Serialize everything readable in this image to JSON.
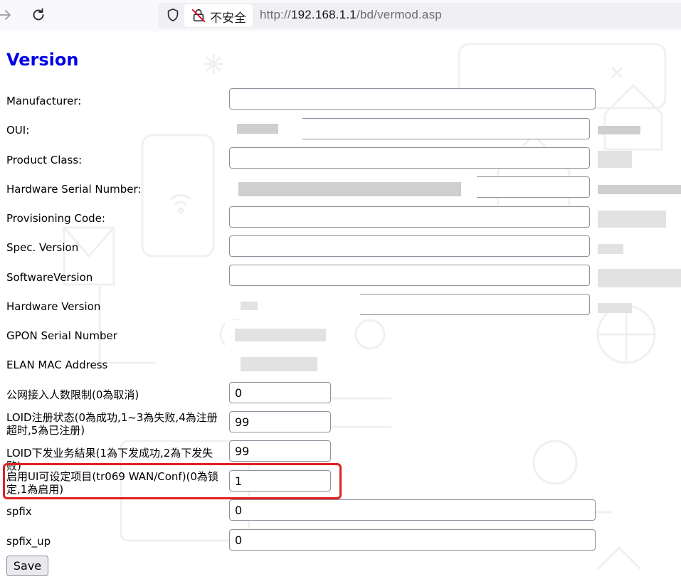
{
  "browser": {
    "security_label": "不安全",
    "url_scheme": "http://",
    "url_host": "192.168.1.1",
    "url_path": "/bd/vermod.asp"
  },
  "page": {
    "title": "Version"
  },
  "fields": [
    {
      "label": "Manufacturer:",
      "value": ""
    },
    {
      "label": "OUI:",
      "value": ""
    },
    {
      "label": "Product Class:",
      "value": ""
    },
    {
      "label": "Hardware Serial Number:",
      "value": ""
    },
    {
      "label": "Provisioning Code:",
      "value": ""
    },
    {
      "label": "Spec. Version",
      "value": ""
    },
    {
      "label": "SoftwareVersion",
      "value": ""
    },
    {
      "label": "Hardware Version",
      "value": ""
    },
    {
      "label": "GPON Serial Number",
      "value": ""
    },
    {
      "label": "ELAN MAC Address",
      "value": ""
    },
    {
      "label": "公网接入人数限制(0為取消)",
      "value": "0"
    },
    {
      "label": "LOID注册状态(0為成功,1~3為失败,4為注册超时,5為已注册)",
      "value": "99"
    },
    {
      "label": "LOID下发业务結果(1為下发成功,2為下发失败)",
      "value": "99"
    },
    {
      "label": "启用UI可设定项目(tr069 WAN/Conf)(0為锁定,1為启用)",
      "value": "1"
    },
    {
      "label": "spfix",
      "value": "0"
    },
    {
      "label": "spfix_up",
      "value": "0"
    }
  ],
  "save_label": "Save",
  "colors": {
    "title": "#0000e6",
    "highlight": "#e02020"
  },
  "icons": [
    "forward-arrow-icon",
    "reload-icon",
    "shield-icon",
    "insecure-lock-icon"
  ]
}
